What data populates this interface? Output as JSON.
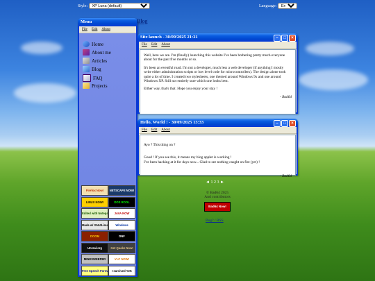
{
  "top": {
    "style_label": "Style:",
    "style_value": "XP Luna (default)",
    "language_label": "Language:",
    "language_value": "English"
  },
  "page_title": "Blog",
  "menu_window": {
    "title": "Menu",
    "menubar": [
      "File",
      "Edit",
      "About"
    ],
    "items": [
      {
        "label": "Home",
        "icon": "home-icon"
      },
      {
        "label": "About me",
        "icon": "book-icon"
      },
      {
        "label": "Articles",
        "icon": "document-icon"
      },
      {
        "label": "Blog",
        "icon": "blog-icon"
      },
      {
        "label": "FAQ",
        "icon": "help-icon"
      },
      {
        "label": "Projects",
        "icon": "folder-icon"
      }
    ],
    "badges": [
      {
        "text": "Firefox Now!",
        "bg": "#f2e0b0",
        "fg": "#c03000"
      },
      {
        "text": "NETSCAPE NOW!",
        "bg": "#1a3a6a",
        "fg": "#ffffff"
      },
      {
        "text": "LINUX NOW!",
        "bg": "#ffd000",
        "fg": "#000000"
      },
      {
        "text": "DOS ROOL",
        "bg": "#000000",
        "fg": "#00ff00"
      },
      {
        "text": "Edited with Notepad++",
        "bg": "#e0f0c0",
        "fg": "#1a5a00"
      },
      {
        "text": "JAVA NOW",
        "bg": "#ffffff",
        "fg": "#c00000"
      },
      {
        "text": "Made w/ GNU/Linux",
        "bg": "#e8e8e8",
        "fg": "#000000"
      },
      {
        "text": "Windows",
        "bg": "#ffffff",
        "fg": "#0030a0"
      },
      {
        "text": "DOOM",
        "bg": "#8a2000",
        "fg": "#ffcc00"
      },
      {
        "text": "DNF",
        "bg": "#000000",
        "fg": "#ffffff"
      },
      {
        "text": "Unreal.org",
        "bg": "#101010",
        "fg": "#ffffff"
      },
      {
        "text": "Get Quake Now!",
        "bg": "#404040",
        "fg": "#e0c080"
      },
      {
        "text": "MINESWEEPER",
        "bg": "#c0c0c0",
        "fg": "#000000"
      },
      {
        "text": "VLC NOW!",
        "bg": "#ffffff",
        "fg": "#e07000"
      },
      {
        "text": "Free Speech Forever!",
        "bg": "#ffff80",
        "fg": "#0000a0"
      },
      {
        "text": "I survived Y2K",
        "bg": "#ffffff",
        "fg": "#000000"
      }
    ]
  },
  "posts": [
    {
      "title": "Site launch - 30/09/2025 21:21",
      "menubar": [
        "File",
        "Edit",
        "About"
      ],
      "paragraphs": [
        "Well, here we are. I'm (finally) launching this website I've been bothering pretty much everyone about for the past five months or so.",
        "It's been an eventful road. I'm not a developer, much less a web developer (if anything I mostly write either administration scripts or low level code for microcontrollers). The design alone took quite a lot of time. I created two stylesheets, one themed around Windows 9x and one around Windows XP. Still not entirely sure which one looks best.",
        "Either way, that's that. Hope you enjoy your stay !"
      ],
      "signature": "- Bad64"
    },
    {
      "title": "Hello, World ! - 30/09/2025 13:33",
      "menubar": [
        "File",
        "Edit",
        "About"
      ],
      "paragraphs": [
        "Ayo ? This thing on ?",
        "Good ! If you see this, it means my blog applet is working !\nI've been hacking at it for days now... Glad to see nothing caught on fire (yet) !"
      ],
      "signature": "- Bad64"
    }
  ],
  "pagination": "◄ 1 2 3 ►",
  "footer": {
    "line1": "© Bad64 2025",
    "line2": "And contributors",
    "badge_text": "Bad64 Now!",
    "link": "Bug? / RSS"
  }
}
